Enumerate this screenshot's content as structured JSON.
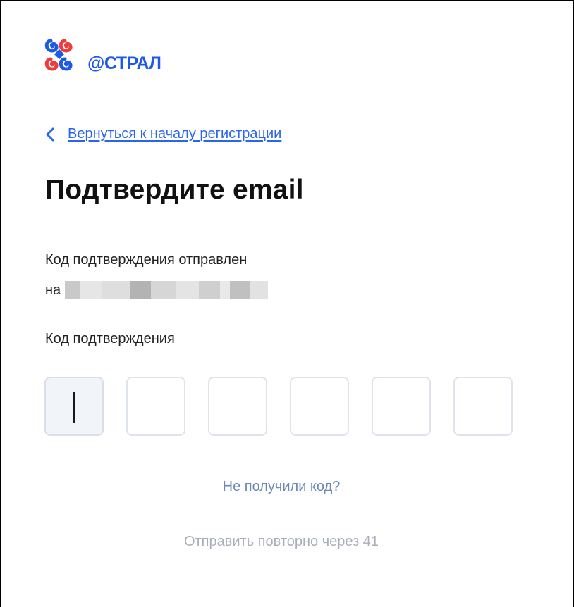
{
  "brand": {
    "logo_text": "@СТРАЛ",
    "colors": {
      "blue": "#1e5ae6",
      "red": "#ef3b3b"
    },
    "icon": "astral-logo-mark"
  },
  "back_link": {
    "icon": "chevron-left-icon",
    "label": "Вернуться к началу регистрации"
  },
  "title": "Подтвердите email",
  "message": {
    "line1": "Код подтверждения отправлен",
    "prefix": "на"
  },
  "code": {
    "label": "Код подтверждения",
    "length": 6,
    "active_index": 0,
    "values": [
      "",
      "",
      "",
      "",
      "",
      ""
    ]
  },
  "help": {
    "no_code_link": "Не получили код?",
    "resend_text": "Отправить повторно через 41"
  },
  "colors": {
    "link": "#2a66e8",
    "muted_link": "#6d87b7",
    "disabled_text": "#a9afb9",
    "input_border": "#dfe4ec",
    "input_active_bg": "#f1f4f9"
  }
}
